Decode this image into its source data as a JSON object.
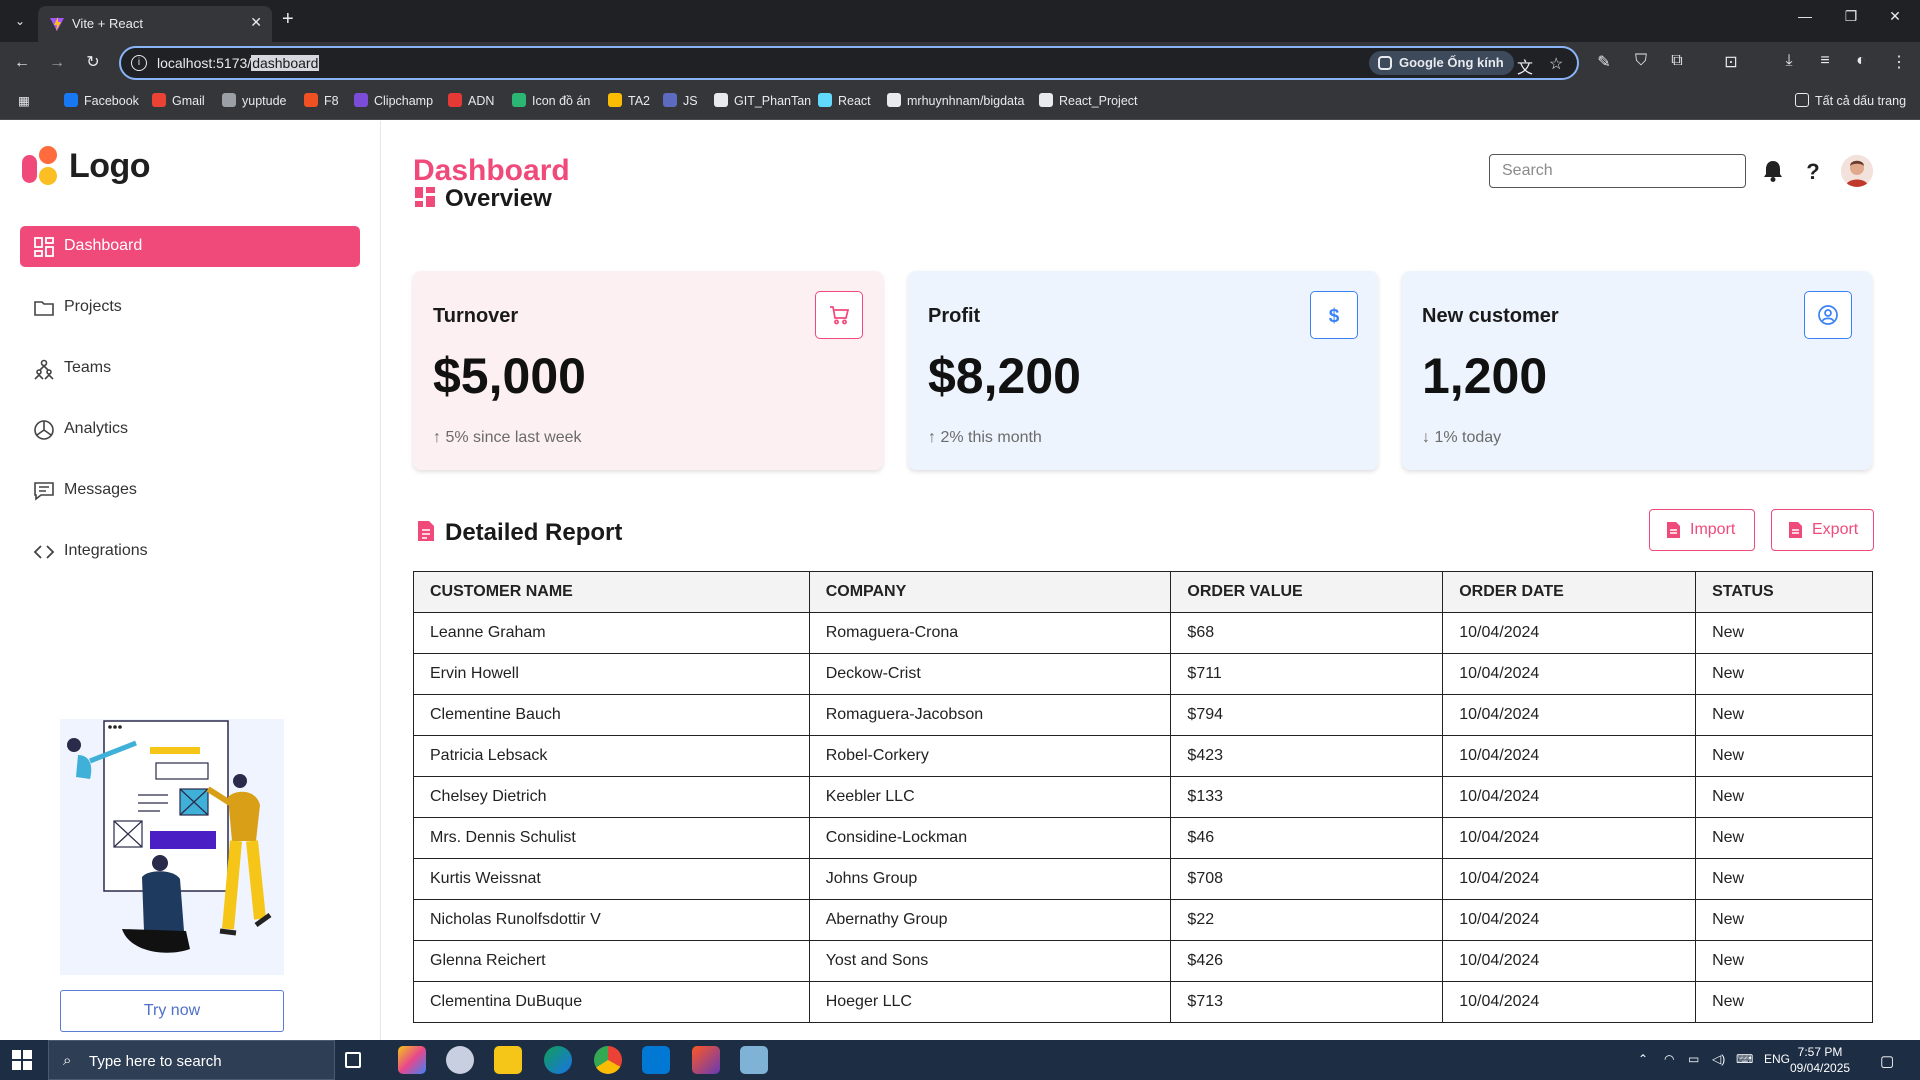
{
  "browser": {
    "tab_title": "Vite + React",
    "url_prefix": "localhost:5173/",
    "url_highlight": "dashboard",
    "lens_label": "Google Ống kính",
    "bookmarks": [
      {
        "label": "Facebook",
        "color": "#1877f2"
      },
      {
        "label": "Gmail",
        "color": "#ea4335"
      },
      {
        "label": "yuptude",
        "color": "#9aa0a6"
      },
      {
        "label": "F8",
        "color": "#f05123"
      },
      {
        "label": "Clipchamp",
        "color": "#7b4dd6"
      },
      {
        "label": "ADN",
        "color": "#e53935"
      },
      {
        "label": "Icon đồ án",
        "color": "#2bb673"
      },
      {
        "label": "TA2",
        "color": "#fbbc04"
      },
      {
        "label": "JS",
        "color": "#5c6bc0"
      },
      {
        "label": "GIT_PhanTan",
        "color": "#e8eaed"
      },
      {
        "label": "React",
        "color": "#61dafb"
      },
      {
        "label": "mrhuynhnam/bigdata",
        "color": "#e8eaed"
      },
      {
        "label": "React_Project",
        "color": "#e8eaed"
      }
    ],
    "all_bookmarks": "Tất cả dấu trang"
  },
  "sidebar": {
    "logo_text": "Logo",
    "items": [
      {
        "label": "Dashboard",
        "icon": "dashboard-icon",
        "active": true
      },
      {
        "label": "Projects",
        "icon": "folder-icon"
      },
      {
        "label": "Teams",
        "icon": "teams-icon"
      },
      {
        "label": "Analytics",
        "icon": "pie-chart-icon"
      },
      {
        "label": "Messages",
        "icon": "message-icon"
      },
      {
        "label": "Integrations",
        "icon": "code-icon"
      }
    ],
    "try_now": "Try now"
  },
  "header": {
    "title": "Dashboard",
    "search_placeholder": "Search"
  },
  "overview": {
    "title": "Overview",
    "cards": [
      {
        "title": "Turnover",
        "value": "$5,000",
        "delta": "↑ 5% since last week",
        "icon": "cart-icon",
        "bg": "#fdf0f2",
        "accent": "#f04a7b"
      },
      {
        "title": "Profit",
        "value": "$8,200",
        "delta": "↑ 2% this month",
        "icon": "dollar-icon",
        "bg": "#eef4fd",
        "accent": "#3b82f6"
      },
      {
        "title": "New customer",
        "value": "1,200",
        "delta": "↓ 1% today",
        "icon": "user-circle-icon",
        "bg": "#eef4fd",
        "accent": "#3b82f6"
      }
    ]
  },
  "report": {
    "title": "Detailed Report",
    "import_label": "Import",
    "export_label": "Export",
    "columns": [
      "CUSTOMER NAME",
      "COMPANY",
      "ORDER VALUE",
      "ORDER DATE",
      "STATUS"
    ],
    "rows": [
      [
        "Leanne Graham",
        "Romaguera-Crona",
        "$68",
        "10/04/2024",
        "New"
      ],
      [
        "Ervin Howell",
        "Deckow-Crist",
        "$711",
        "10/04/2024",
        "New"
      ],
      [
        "Clementine Bauch",
        "Romaguera-Jacobson",
        "$794",
        "10/04/2024",
        "New"
      ],
      [
        "Patricia Lebsack",
        "Robel-Corkery",
        "$423",
        "10/04/2024",
        "New"
      ],
      [
        "Chelsey Dietrich",
        "Keebler LLC",
        "$133",
        "10/04/2024",
        "New"
      ],
      [
        "Mrs. Dennis Schulist",
        "Considine-Lockman",
        "$46",
        "10/04/2024",
        "New"
      ],
      [
        "Kurtis Weissnat",
        "Johns Group",
        "$708",
        "10/04/2024",
        "New"
      ],
      [
        "Nicholas Runolfsdottir V",
        "Abernathy Group",
        "$22",
        "10/04/2024",
        "New"
      ],
      [
        "Glenna Reichert",
        "Yost and Sons",
        "$426",
        "10/04/2024",
        "New"
      ],
      [
        "Clementina DuBuque",
        "Hoeger LLC",
        "$713",
        "10/04/2024",
        "New"
      ]
    ]
  },
  "taskbar": {
    "search_text": "Type here to search",
    "lang": "ENG",
    "time": "7:57 PM",
    "date": "09/04/2025"
  },
  "colors": {
    "brand_pink": "#f04a7b",
    "accent_blue": "#3b82f6"
  }
}
